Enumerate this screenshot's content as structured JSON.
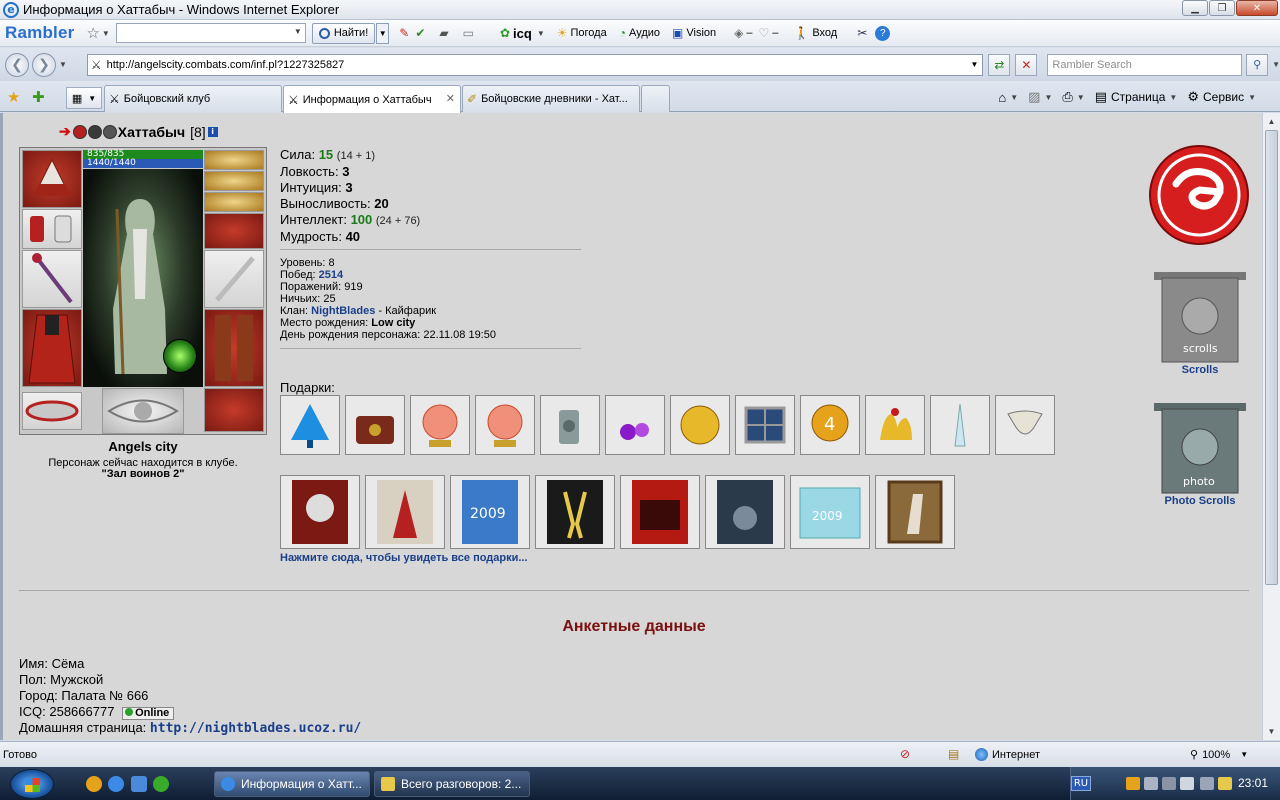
{
  "window": {
    "title": "Информация о Хаттабыч - Windows Internet Explorer"
  },
  "rambler_toolbar": {
    "logo": "Rambler",
    "search_value": "",
    "find_label": "Найти!",
    "icq_label": "icq",
    "weather_label": "Погода",
    "audio_label": "Аудио",
    "vision_label": "Vision",
    "bookmark_dash": "–",
    "heart_dash": "–",
    "login_label": "Вход"
  },
  "address_bar": {
    "url": "http://angelscity.combats.com/inf.pl?1227325827",
    "search_placeholder": "Rambler Search"
  },
  "tabs": [
    {
      "label": "Бойцовский клуб",
      "active": false
    },
    {
      "label": "Информация о Хаттабыч",
      "active": true
    },
    {
      "label": "Бойцовские дневники - Хат...",
      "active": false
    }
  ],
  "command_bar": {
    "page_label": "Страница",
    "service_label": "Сервис"
  },
  "character": {
    "name": "Хаттабыч",
    "level": "[8]",
    "hp": "835/835",
    "mp": "1440/1440",
    "city": "Angels city",
    "location_text": "Персонаж сейчас находится в клубе.",
    "location_room": "\"Зал воинов 2\""
  },
  "stats": [
    {
      "label": "Сила:",
      "value": "15",
      "extra": "(14 + 1)",
      "green": true
    },
    {
      "label": "Ловкость:",
      "value": "3",
      "extra": "",
      "green": false
    },
    {
      "label": "Интуиция:",
      "value": "3",
      "extra": "",
      "green": false
    },
    {
      "label": "Выносливость:",
      "value": "20",
      "extra": "",
      "green": false
    },
    {
      "label": "Интеллект:",
      "value": "100",
      "extra": "(24 + 76)",
      "green": true
    },
    {
      "label": "Мудрость:",
      "value": "40",
      "extra": "",
      "green": false
    }
  ],
  "info": {
    "level_label": "Уровень:",
    "level_value": "8",
    "wins_label": "Побед:",
    "wins_value": "2514",
    "losses_label": "Поражений:",
    "losses_value": "919",
    "draws_label": "Ничьих:",
    "draws_value": "25",
    "clan_label": "Клан:",
    "clan_value": "NightBlades",
    "clan_rank": "- Кайфарик",
    "birthplace_label": "Место рождения:",
    "birthplace_value": "Low city",
    "birthday_label": "День рождения персонажа:",
    "birthday_value": "22.11.08 19:50"
  },
  "gifts": {
    "label": "Подарки:",
    "link": "Нажмите сюда, чтобы увидеть все подарки..."
  },
  "banners": {
    "scrolls_label": "Scrolls",
    "photo_label": "Photo Scrolls"
  },
  "profile": {
    "heading": "Анкетные данные",
    "name_label": "Имя:",
    "name_value": "Сёма",
    "gender_label": "Пол:",
    "gender_value": "Мужской",
    "city_label": "Город:",
    "city_value": "Палата № 666",
    "icq_label": "ICQ:",
    "icq_value": "258666777",
    "icq_status": "Online",
    "homepage_label": "Домашняя страница:",
    "homepage_value": "http://nightblades.ucoz.ru/"
  },
  "status_bar": {
    "text": "Готово",
    "zone": "Интернет",
    "zoom": "100%"
  },
  "taskbar": {
    "tasks": [
      {
        "label": "Информация о Хатт...",
        "active": true
      },
      {
        "label": "Всего разговоров: 2...",
        "active": false
      }
    ],
    "lang": "RU",
    "time": "23:01"
  },
  "colors": {
    "page_bg": "#d7d7d7",
    "link_blue": "#1a3f8a",
    "stat_green": "#1a7a1a",
    "heading_red": "#7a1010"
  }
}
